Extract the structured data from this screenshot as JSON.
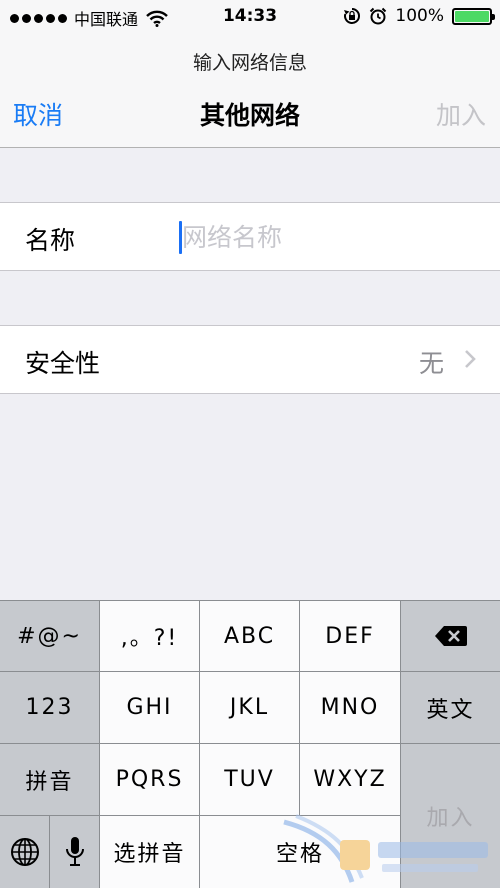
{
  "status_bar": {
    "carrier": "中国联通",
    "time": "14:33",
    "battery": "100%",
    "battery_color": "#4cd964",
    "icons": [
      "signal-dots-icon",
      "wifi-icon",
      "rotation-lock-icon",
      "alarm-icon",
      "battery-icon"
    ]
  },
  "nav": {
    "prompt": "输入网络信息",
    "cancel": "取消",
    "title": "其他网络",
    "join": "加入",
    "accent_color": "#1a7cf5"
  },
  "form": {
    "name_label": "名称",
    "name_placeholder": "网络名称",
    "name_value": "",
    "security_label": "安全性",
    "security_value": "无"
  },
  "keyboard": {
    "symbols": "#@~",
    "punct": ",。?!",
    "abc": "ABC",
    "def": "DEF",
    "num": "123",
    "ghi": "GHI",
    "jkl": "JKL",
    "mno": "MNO",
    "english": "英文",
    "pinyin": "拼音",
    "pqrs": "PQRS",
    "tuv": "TUV",
    "wxyz": "WXYZ",
    "select_pinyin": "选拼音",
    "space": "空格",
    "join": "加入",
    "icons": [
      "delete-icon",
      "globe-icon",
      "microphone-icon"
    ]
  }
}
